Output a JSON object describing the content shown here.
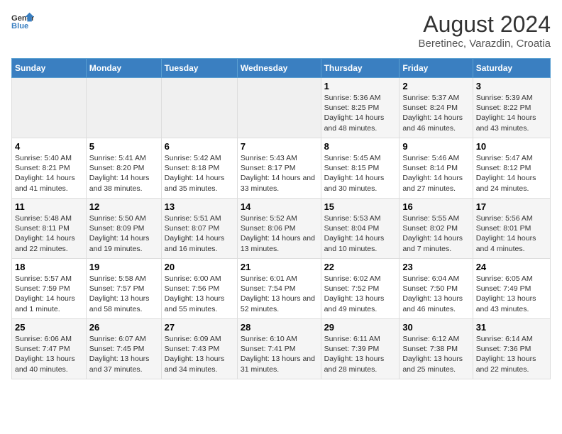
{
  "header": {
    "logo_line1": "General",
    "logo_line2": "Blue",
    "title": "August 2024",
    "subtitle": "Beretinec, Varazdin, Croatia"
  },
  "weekdays": [
    "Sunday",
    "Monday",
    "Tuesday",
    "Wednesday",
    "Thursday",
    "Friday",
    "Saturday"
  ],
  "weeks": [
    [
      {
        "day": "",
        "info": ""
      },
      {
        "day": "",
        "info": ""
      },
      {
        "day": "",
        "info": ""
      },
      {
        "day": "",
        "info": ""
      },
      {
        "day": "1",
        "info": "Sunrise: 5:36 AM\nSunset: 8:25 PM\nDaylight: 14 hours and 48 minutes."
      },
      {
        "day": "2",
        "info": "Sunrise: 5:37 AM\nSunset: 8:24 PM\nDaylight: 14 hours and 46 minutes."
      },
      {
        "day": "3",
        "info": "Sunrise: 5:39 AM\nSunset: 8:22 PM\nDaylight: 14 hours and 43 minutes."
      }
    ],
    [
      {
        "day": "4",
        "info": "Sunrise: 5:40 AM\nSunset: 8:21 PM\nDaylight: 14 hours and 41 minutes."
      },
      {
        "day": "5",
        "info": "Sunrise: 5:41 AM\nSunset: 8:20 PM\nDaylight: 14 hours and 38 minutes."
      },
      {
        "day": "6",
        "info": "Sunrise: 5:42 AM\nSunset: 8:18 PM\nDaylight: 14 hours and 35 minutes."
      },
      {
        "day": "7",
        "info": "Sunrise: 5:43 AM\nSunset: 8:17 PM\nDaylight: 14 hours and 33 minutes."
      },
      {
        "day": "8",
        "info": "Sunrise: 5:45 AM\nSunset: 8:15 PM\nDaylight: 14 hours and 30 minutes."
      },
      {
        "day": "9",
        "info": "Sunrise: 5:46 AM\nSunset: 8:14 PM\nDaylight: 14 hours and 27 minutes."
      },
      {
        "day": "10",
        "info": "Sunrise: 5:47 AM\nSunset: 8:12 PM\nDaylight: 14 hours and 24 minutes."
      }
    ],
    [
      {
        "day": "11",
        "info": "Sunrise: 5:48 AM\nSunset: 8:11 PM\nDaylight: 14 hours and 22 minutes."
      },
      {
        "day": "12",
        "info": "Sunrise: 5:50 AM\nSunset: 8:09 PM\nDaylight: 14 hours and 19 minutes."
      },
      {
        "day": "13",
        "info": "Sunrise: 5:51 AM\nSunset: 8:07 PM\nDaylight: 14 hours and 16 minutes."
      },
      {
        "day": "14",
        "info": "Sunrise: 5:52 AM\nSunset: 8:06 PM\nDaylight: 14 hours and 13 minutes."
      },
      {
        "day": "15",
        "info": "Sunrise: 5:53 AM\nSunset: 8:04 PM\nDaylight: 14 hours and 10 minutes."
      },
      {
        "day": "16",
        "info": "Sunrise: 5:55 AM\nSunset: 8:02 PM\nDaylight: 14 hours and 7 minutes."
      },
      {
        "day": "17",
        "info": "Sunrise: 5:56 AM\nSunset: 8:01 PM\nDaylight: 14 hours and 4 minutes."
      }
    ],
    [
      {
        "day": "18",
        "info": "Sunrise: 5:57 AM\nSunset: 7:59 PM\nDaylight: 14 hours and 1 minute."
      },
      {
        "day": "19",
        "info": "Sunrise: 5:58 AM\nSunset: 7:57 PM\nDaylight: 13 hours and 58 minutes."
      },
      {
        "day": "20",
        "info": "Sunrise: 6:00 AM\nSunset: 7:56 PM\nDaylight: 13 hours and 55 minutes."
      },
      {
        "day": "21",
        "info": "Sunrise: 6:01 AM\nSunset: 7:54 PM\nDaylight: 13 hours and 52 minutes."
      },
      {
        "day": "22",
        "info": "Sunrise: 6:02 AM\nSunset: 7:52 PM\nDaylight: 13 hours and 49 minutes."
      },
      {
        "day": "23",
        "info": "Sunrise: 6:04 AM\nSunset: 7:50 PM\nDaylight: 13 hours and 46 minutes."
      },
      {
        "day": "24",
        "info": "Sunrise: 6:05 AM\nSunset: 7:49 PM\nDaylight: 13 hours and 43 minutes."
      }
    ],
    [
      {
        "day": "25",
        "info": "Sunrise: 6:06 AM\nSunset: 7:47 PM\nDaylight: 13 hours and 40 minutes."
      },
      {
        "day": "26",
        "info": "Sunrise: 6:07 AM\nSunset: 7:45 PM\nDaylight: 13 hours and 37 minutes."
      },
      {
        "day": "27",
        "info": "Sunrise: 6:09 AM\nSunset: 7:43 PM\nDaylight: 13 hours and 34 minutes."
      },
      {
        "day": "28",
        "info": "Sunrise: 6:10 AM\nSunset: 7:41 PM\nDaylight: 13 hours and 31 minutes."
      },
      {
        "day": "29",
        "info": "Sunrise: 6:11 AM\nSunset: 7:39 PM\nDaylight: 13 hours and 28 minutes."
      },
      {
        "day": "30",
        "info": "Sunrise: 6:12 AM\nSunset: 7:38 PM\nDaylight: 13 hours and 25 minutes."
      },
      {
        "day": "31",
        "info": "Sunrise: 6:14 AM\nSunset: 7:36 PM\nDaylight: 13 hours and 22 minutes."
      }
    ]
  ]
}
